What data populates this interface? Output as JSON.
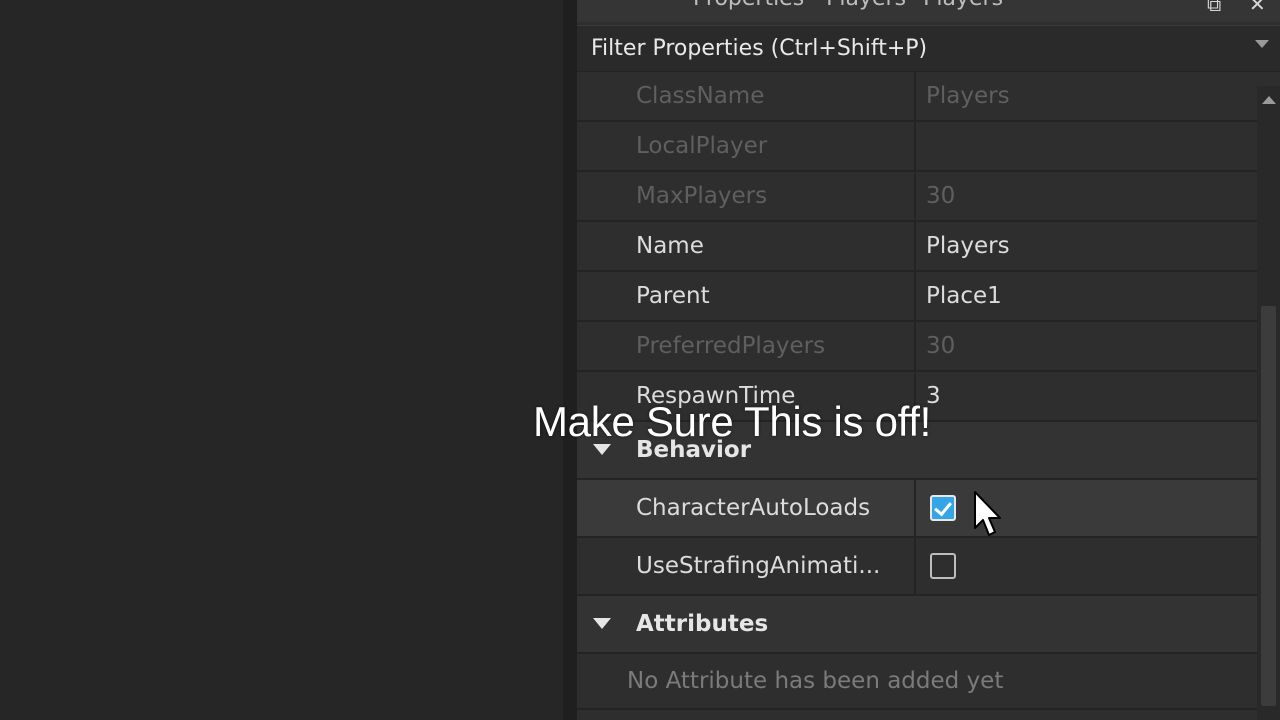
{
  "window": {
    "title": "Properties - Players \"Players\""
  },
  "filter": {
    "placeholder": "Filter Properties (Ctrl+Shift+P)"
  },
  "properties": [
    {
      "name": "ClassName",
      "value": "Players",
      "disabled": true
    },
    {
      "name": "LocalPlayer",
      "value": "",
      "disabled": true
    },
    {
      "name": "MaxPlayers",
      "value": "30",
      "disabled": true
    },
    {
      "name": "Name",
      "value": "Players",
      "disabled": false
    },
    {
      "name": "Parent",
      "value": "Place1",
      "disabled": false
    },
    {
      "name": "PreferredPlayers",
      "value": "30",
      "disabled": true
    },
    {
      "name": "RespawnTime",
      "value": "3",
      "disabled": false
    }
  ],
  "behavior": {
    "title": "Behavior",
    "items": [
      {
        "name": "CharacterAutoLoads",
        "checked": true
      },
      {
        "name": "UseStrafingAnimati...",
        "checked": false
      }
    ]
  },
  "attributes": {
    "title": "Attributes",
    "empty_text": "No Attribute has been added yet"
  },
  "overlay": {
    "caption": "Make Sure This is off!"
  },
  "colors": {
    "checkbox_on": "#35a5e8",
    "panel_bg": "#2e2e2e",
    "viewport_bg": "#262626"
  }
}
